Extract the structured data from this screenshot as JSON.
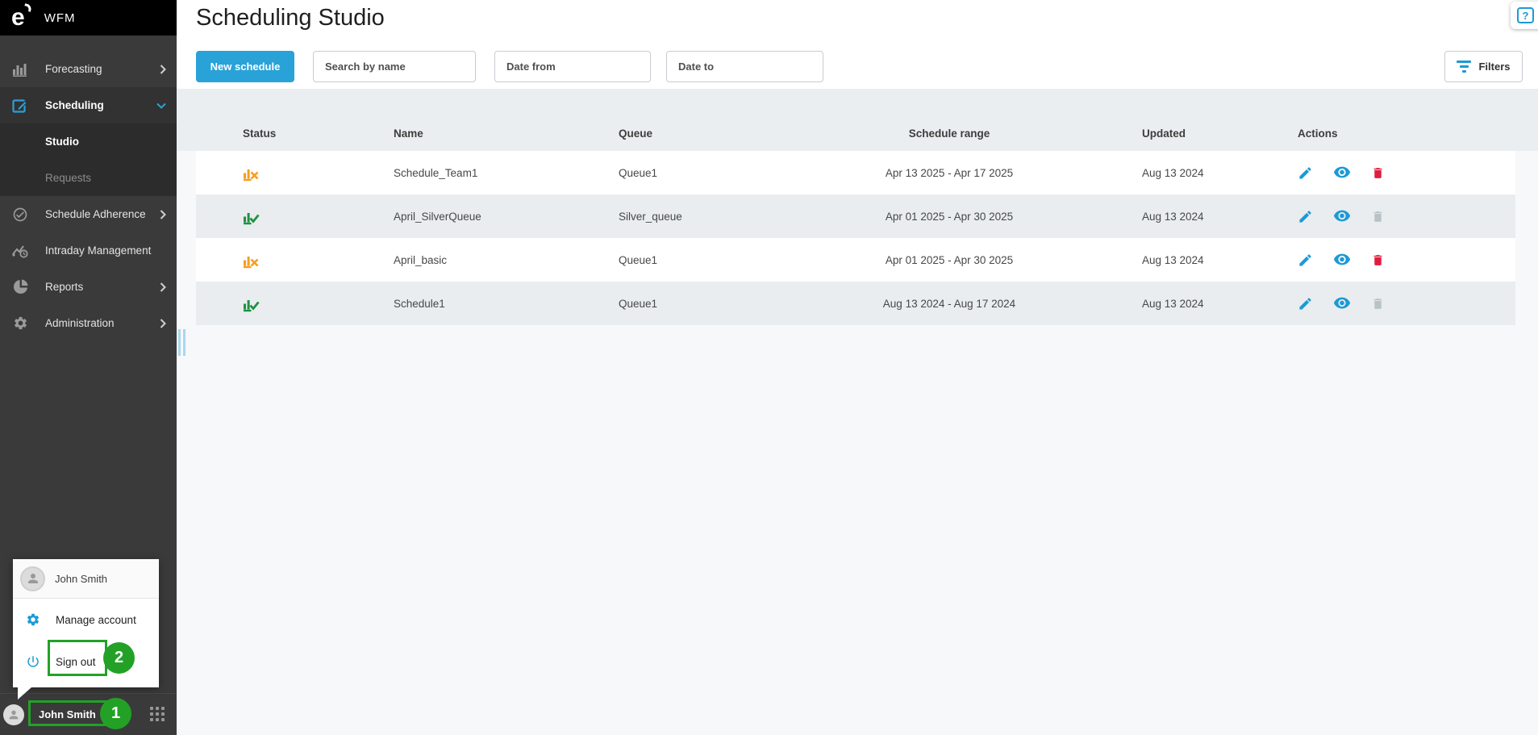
{
  "app": {
    "brand": "WFM",
    "logo_letter": "e"
  },
  "sidebar": {
    "items": {
      "forecasting": "Forecasting",
      "scheduling": "Scheduling",
      "studio": "Studio",
      "requests": "Requests",
      "adherence": "Schedule Adherence",
      "intraday": "Intraday Management",
      "reports": "Reports",
      "administration": "Administration"
    },
    "user_name": "John Smith"
  },
  "user_menu": {
    "name": "John Smith",
    "manage_account": "Manage account",
    "sign_out": "Sign out"
  },
  "annotations": {
    "step1": "1",
    "step2": "2",
    "color": "#23a127"
  },
  "header": {
    "title": "Scheduling Studio",
    "new_schedule_label": "New schedule",
    "search_placeholder": "Search by name",
    "date_from_placeholder": "Date from",
    "date_to_placeholder": "Date to",
    "filters_label": "Filters",
    "help_label": "?"
  },
  "table": {
    "columns": [
      "Status",
      "Name",
      "Queue",
      "Schedule range",
      "Updated",
      "Actions"
    ],
    "rows": [
      {
        "status": "error",
        "name": "Schedule_Team1",
        "queue": "Queue1",
        "range": "Apr 13 2025 - Apr 17 2025",
        "updated": "Aug 13 2024",
        "delete_enabled": true
      },
      {
        "status": "ok",
        "name": "April_SilverQueue",
        "queue": "Silver_queue",
        "range": "Apr 01 2025 - Apr 30 2025",
        "updated": "Aug 13 2024",
        "delete_enabled": false
      },
      {
        "status": "error",
        "name": "April_basic",
        "queue": "Queue1",
        "range": "Apr 01 2025 - Apr 30 2025",
        "updated": "Aug 13 2024",
        "delete_enabled": true
      },
      {
        "status": "ok",
        "name": "Schedule1",
        "queue": "Queue1",
        "range": "Aug 13 2024 - Aug 17 2024",
        "updated": "Aug 13 2024",
        "delete_enabled": false
      }
    ]
  },
  "colors": {
    "accent_blue": "#29a2d8",
    "action_blue": "#1c9ad6",
    "status_orange": "#f59e1f",
    "status_green": "#1e9143",
    "delete_red": "#e11d3f",
    "sidebar_bg": "#3a3a3a",
    "band_bg": "#ebeef0",
    "alt_row_bg": "#e9edef"
  }
}
